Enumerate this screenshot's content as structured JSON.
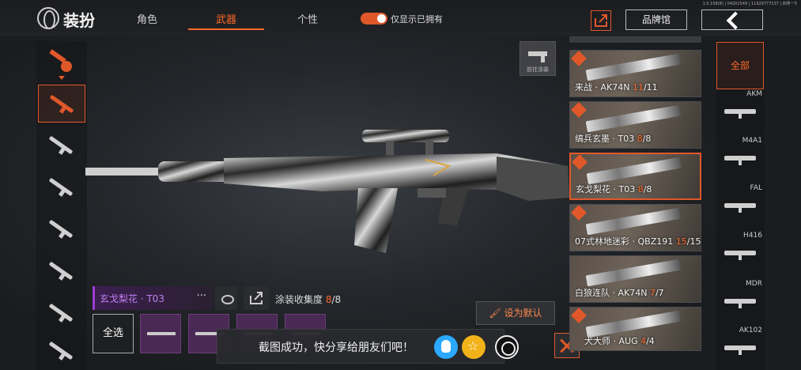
{
  "header": {
    "title": "装扮",
    "tabs": [
      {
        "label": "角色",
        "active": false
      },
      {
        "label": "武器",
        "active": true
      },
      {
        "label": "个性",
        "active": false
      }
    ],
    "toggle_label": "仅显示已拥有",
    "toggle_on": true,
    "brand_button": "品牌馆",
    "version": "1.0.158(8) | 04201549 | 11929777237 | 四男一5"
  },
  "weapon_view": {
    "paint_button_label": "前往涂装"
  },
  "selected_skin": {
    "name": "玄戈梨花 · T03",
    "more": "···",
    "collect_label": "涂装收集度",
    "collect_current": "8",
    "collect_total": "/8"
  },
  "actions": {
    "set_default": "设为默认",
    "select_all": "全选"
  },
  "toast": {
    "text": "截图成功，快分享给朋友们吧！"
  },
  "skin_list": [
    {
      "name": "来战 · AK74N",
      "count": "11",
      "total": "/11",
      "selected": false
    },
    {
      "name": "缟兵玄墨 · T03",
      "count": "8",
      "total": "/8",
      "selected": false
    },
    {
      "name": "玄戈梨花 · T03",
      "count": "8",
      "total": "/8",
      "selected": true
    },
    {
      "name": "07式林地迷彩 · QBZ191",
      "count": "15",
      "total": "/15",
      "selected": false
    },
    {
      "name": "白狼连队 · AK74N",
      "count": "7",
      "total": "/7",
      "selected": false
    },
    {
      "name": "犬大师 · AUG",
      "count": "4",
      "total": "/4",
      "selected": false
    }
  ],
  "weapon_filter": {
    "all_label": "全部",
    "items": [
      "AKM",
      "M4A1",
      "FAL",
      "H416",
      "MDR",
      "AK102"
    ]
  },
  "colors": {
    "accent": "#e0582a",
    "purple_rarity": "#9b3fd1"
  }
}
